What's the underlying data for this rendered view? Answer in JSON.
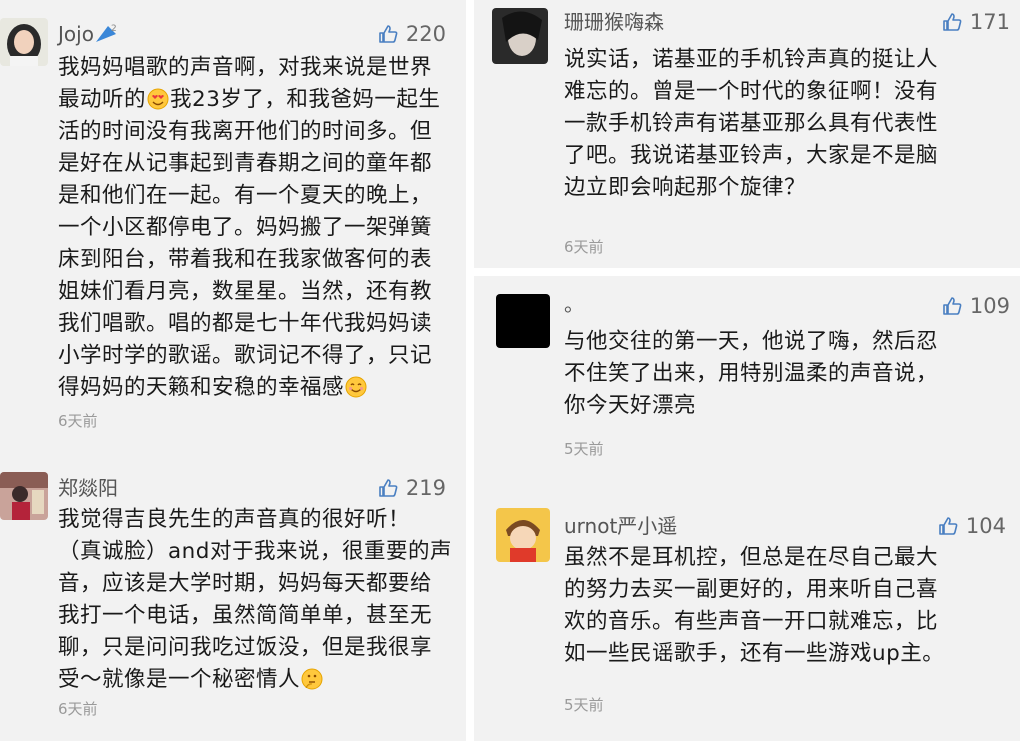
{
  "left_panel": {
    "comments": [
      {
        "username": "Jojo",
        "likes": "220",
        "lines": [
          "我妈妈唱歌的声音啊，对我来说是世界",
          [
            "最动听的",
            "heart-eyes",
            "我23岁了，和我爸妈一起生"
          ],
          "活的时间没有我离开他们的时间多。但",
          "是好在从记事起到青春期之间的童年都",
          "是和他们在一起。有一个夏天的晚上，",
          "一个小区都停电了。妈妈搬了一架弹簧",
          "床到阳台，带着我和在我家做客何的表",
          "姐妹们看月亮，数星星。当然，还有教",
          "我们唱歌。唱的都是七十年代我妈妈读",
          "小学时学的歌谣。歌词记不得了，只记",
          [
            "得妈妈的天籁和安稳的幸福感",
            "smile",
            ""
          ]
        ],
        "time": "6天前"
      },
      {
        "username": "郑燚阳",
        "likes": "219",
        "lines": [
          "我觉得吉良先生的声音真的很好听！",
          "（真诚脸）and对于我来说，很重要的声",
          "音，应该是大学时期，妈妈每天都要给",
          "我打一个电话，虽然简简单单，甚至无",
          "聊，只是问问我吃过饭没，但是我很享",
          [
            "受～就像是一个秘密情人",
            "thinking",
            ""
          ]
        ],
        "time": "6天前"
      }
    ]
  },
  "right_panel": {
    "comments": [
      {
        "username": "珊珊猴嗨森",
        "likes": "171",
        "lines": [
          "说实话，诺基亚的手机铃声真的挺让人",
          "难忘的。曾是一个时代的象征啊！没有",
          "一款手机铃声有诺基亚那么具有代表性",
          "了吧。我说诺基亚铃声，大家是不是脑",
          "边立即会响起那个旋律？"
        ],
        "time": "6天前"
      },
      {
        "username": "。",
        "likes": "109",
        "lines": [
          "与他交往的第一天，他说了嗨，然后忍",
          "不住笑了出来，用特别温柔的声音说，",
          "你今天好漂亮"
        ],
        "time": "5天前"
      },
      {
        "username": "urnot严小遥",
        "likes": "104",
        "lines": [
          "虽然不是耳机控，但总是在尽自己最大",
          "的努力去买一副更好的，用来听自己喜",
          "欢的音乐。有些声音一开口就难忘，比",
          "如一些民谣歌手，还有一些游戏up主。"
        ],
        "time": "5天前"
      }
    ]
  },
  "colors": {
    "panel_bg": "#f2f2f2",
    "text": "#1a1a1a",
    "meta": "#9a9a9a",
    "thumb": "#4a7fc1"
  }
}
